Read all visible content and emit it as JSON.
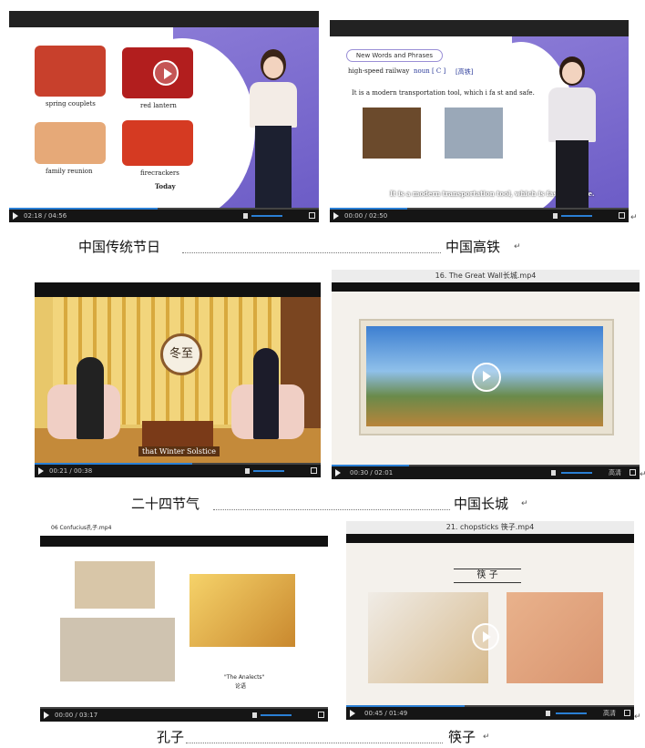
{
  "rows": [
    {
      "left_caption": "中国传统节日",
      "right_caption": "中国高铁",
      "left_player": {
        "time": "02:18 / 04:56",
        "items": [
          "spring couplets",
          "red lantern",
          "family reunion",
          "firecrackers"
        ],
        "today": "Today"
      },
      "right_player": {
        "time": "00:00 / 02:50",
        "banner": "New Words and Phrases",
        "word": "high-speed railway",
        "pos": "noun [ C ]",
        "gloss": "[高铁]",
        "sentence": "It is a modern transportation tool, which i  fa st and safe.",
        "subtitle": "It is a modern transportation tool, which is fast and safe."
      }
    },
    {
      "left_caption": "二十四节气",
      "right_caption": "中国长城",
      "left_player": {
        "time": "00:21 / 00:38",
        "subtitle": "that Winter Solstice",
        "emblem": "冬至"
      },
      "right_player": {
        "title": "16. The Great Wall长城.mp4",
        "time": "00:30 / 02:01",
        "quality": "高清"
      }
    },
    {
      "left_caption": "孔子",
      "right_caption": "筷子",
      "left_player": {
        "title": "06 Confucius孔子.mp4",
        "book_label": "\"The Analects\"",
        "book_label_cn": "论语",
        "time": "00:00 / 03:17"
      },
      "right_player": {
        "title": "21. chopsticks 筷子.mp4",
        "heading": "筷 子",
        "time": "00:45 / 01:49",
        "quality": "高清"
      }
    }
  ],
  "return_mark": "↵",
  "accent": "#2a7fd4"
}
